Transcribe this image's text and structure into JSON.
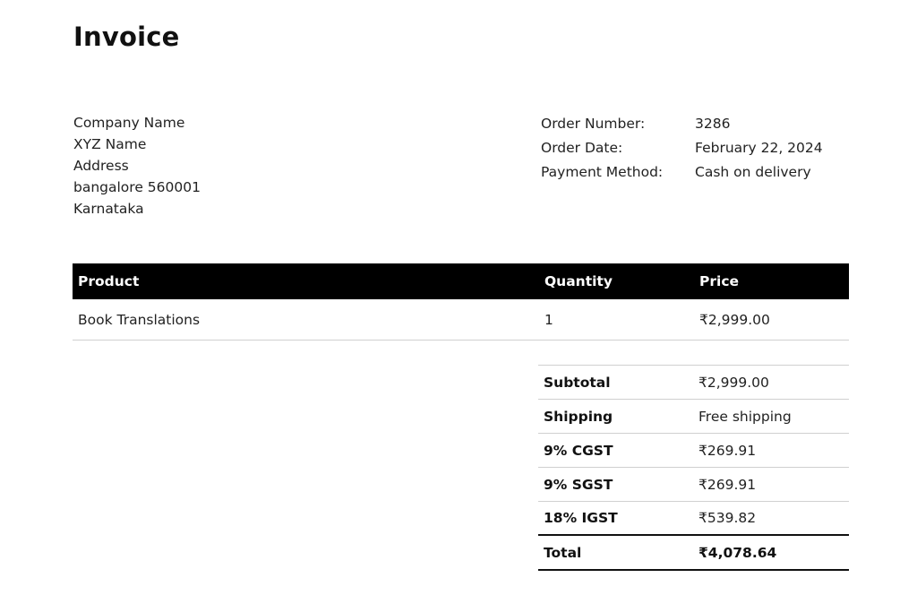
{
  "document": {
    "title": "Invoice"
  },
  "billing_address": [
    "Company Name",
    "XYZ Name",
    "Address",
    "bangalore 560001",
    "Karnataka"
  ],
  "order_meta": [
    {
      "label": "Order Number:",
      "value": "3286"
    },
    {
      "label": "Order Date:",
      "value": "February 22, 2024"
    },
    {
      "label": "Payment Method:",
      "value": "Cash on delivery"
    }
  ],
  "items_table": {
    "headers": {
      "product": "Product",
      "quantity": "Quantity",
      "price": "Price"
    },
    "rows": [
      {
        "product": "Book Translations",
        "quantity": "1",
        "price": "₹2,999.00"
      }
    ]
  },
  "totals": [
    {
      "label": "Subtotal",
      "value": "₹2,999.00"
    },
    {
      "label": "Shipping",
      "value": "Free shipping"
    },
    {
      "label": "9% CGST",
      "value": "₹269.91"
    },
    {
      "label": "9% SGST",
      "value": "₹269.91"
    },
    {
      "label": "18% IGST",
      "value": "₹539.82"
    },
    {
      "label": "Total",
      "value": "₹4,078.64"
    }
  ]
}
